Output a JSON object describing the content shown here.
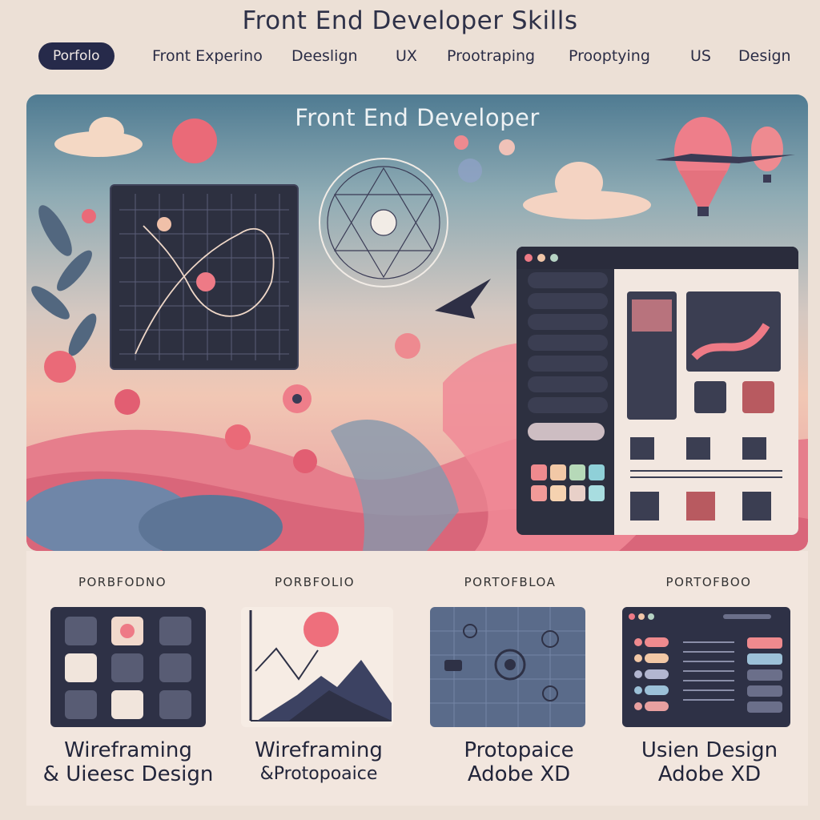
{
  "page": {
    "title": "Front End Developer Skills"
  },
  "nav": {
    "items": [
      {
        "label": "Porfolo",
        "active": true
      },
      {
        "label": "Front Experino",
        "active": false
      },
      {
        "label": "Deeslign",
        "active": false
      },
      {
        "label": "UX",
        "active": false
      },
      {
        "label": "Prootraping",
        "active": false
      },
      {
        "label": "Prooptying",
        "active": false
      },
      {
        "label": "US",
        "active": false
      },
      {
        "label": "Design",
        "active": false
      }
    ]
  },
  "hero": {
    "title": "Front End Developer",
    "icons": [
      "cloud-icon",
      "sun-icon",
      "hot-air-balloon-icon",
      "airplane-icon",
      "sacred-geometry-icon",
      "leaf-icon",
      "flower-icon"
    ]
  },
  "cards": [
    {
      "label": "PORBFODNO",
      "caption_line1": "Wireframing",
      "caption_line2": "& Uieesc Design",
      "icon": "ui-icons-grid-icon"
    },
    {
      "label": "PORBFOLIO",
      "caption_line1": "Wireframing",
      "caption_line2": "&Protopoaice",
      "icon": "chart-mountain-icon"
    },
    {
      "label": "PORTOFBLOA",
      "caption_line1": "Protopaice",
      "caption_line2": "Adobe XD",
      "icon": "prototype-canvas-icon"
    },
    {
      "label": "PORTOFBOO",
      "caption_line1": "Usien Design",
      "caption_line2": "Adobe XD",
      "icon": "app-layout-icon"
    }
  ],
  "colors": {
    "accent_coral": "#ee7a86",
    "navy": "#262a4a",
    "panel_dark": "#2d3040",
    "background": "#ece0d6"
  }
}
